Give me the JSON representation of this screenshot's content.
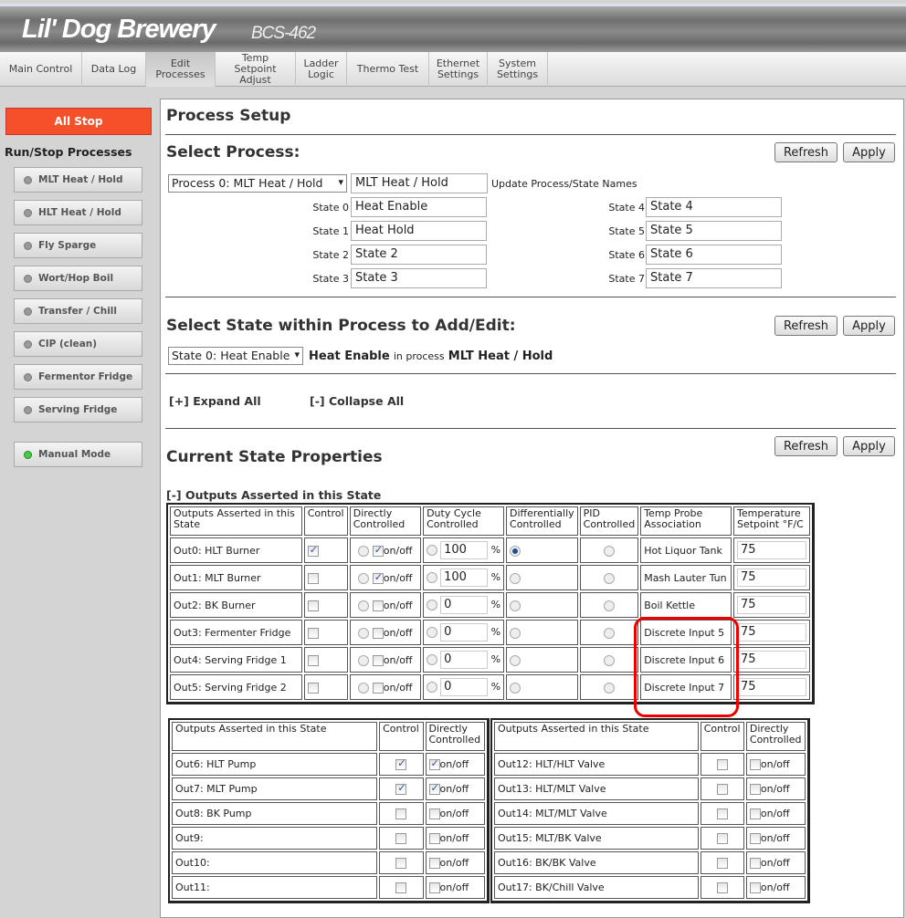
{
  "header": {
    "title": "Lil' Dog Brewery",
    "subtitle": "BCS-462"
  },
  "nav": [
    "Main Control",
    "Data Log",
    "Edit Processes",
    "Temp Setpoint Adjust",
    "Ladder Logic",
    "Thermo Test",
    "Ethernet Settings",
    "System Settings"
  ],
  "nav_active": 2,
  "sidebar": {
    "all_stop": "All Stop",
    "heading": "Run/Stop Processes",
    "processes": [
      "MLT Heat / Hold",
      "HLT Heat / Hold",
      "Fly Sparge",
      "Wort/Hop Boil",
      "Transfer / Chill",
      "CIP (clean)",
      "Fermentor Fridge",
      "Serving Fridge"
    ],
    "manual_mode": "Manual Mode"
  },
  "main": {
    "title": "Process Setup",
    "select_process": {
      "heading": "Select Process:",
      "refresh": "Refresh",
      "apply": "Apply",
      "selected": "Process 0: MLT Heat / Hold",
      "name": "MLT Heat / Hold",
      "update_label": "Update Process/State Names",
      "states": [
        {
          "label": "State 0",
          "value": "Heat Enable"
        },
        {
          "label": "State 1",
          "value": "Heat Hold"
        },
        {
          "label": "State 2",
          "value": "State 2"
        },
        {
          "label": "State 3",
          "value": "State 3"
        },
        {
          "label": "State 4",
          "value": "State 4"
        },
        {
          "label": "State 5",
          "value": "State 5"
        },
        {
          "label": "State 6",
          "value": "State 6"
        },
        {
          "label": "State 7",
          "value": "State 7"
        }
      ]
    },
    "select_state": {
      "heading": "Select State within Process to Add/Edit:",
      "refresh": "Refresh",
      "apply": "Apply",
      "selected": "State 0: Heat Enable",
      "state_name": "Heat Enable",
      "in_process": "in process",
      "process_name": "MLT Heat / Hold"
    },
    "expand": "[+] Expand All",
    "collapse": "[-] Collapse All",
    "current": {
      "heading": "Current State Properties",
      "refresh": "Refresh",
      "apply": "Apply",
      "outputs_heading": "[-] Outputs Asserted in this State"
    },
    "table1": {
      "headers": [
        "Outputs Asserted in this State",
        "Control",
        "Directly Controlled",
        "Duty Cycle Controlled",
        "Differentially Controlled",
        "PID Controlled",
        "Temp Probe Association",
        "Temperature Setpoint °F/C"
      ],
      "onoff": "on/off",
      "pct": "%",
      "rows": [
        {
          "name": "Out0: HLT Burner",
          "control": true,
          "direct": true,
          "duty": "100",
          "diff": true,
          "probe": "Hot Liquor Tank",
          "temp": "75"
        },
        {
          "name": "Out1: MLT Burner",
          "control": false,
          "direct": true,
          "duty": "100",
          "diff": false,
          "probe": "Mash Lauter Tun",
          "temp": "75"
        },
        {
          "name": "Out2: BK Burner",
          "control": false,
          "direct": false,
          "duty": "0",
          "diff": false,
          "probe": "Boil Kettle",
          "temp": "75"
        },
        {
          "name": "Out3: Fermenter Fridge",
          "control": false,
          "direct": false,
          "duty": "0",
          "diff": false,
          "probe": "Discrete Input 5",
          "temp": "75"
        },
        {
          "name": "Out4: Serving Fridge 1",
          "control": false,
          "direct": false,
          "duty": "0",
          "diff": false,
          "probe": "Discrete Input 6",
          "temp": "75"
        },
        {
          "name": "Out5: Serving Fridge 2",
          "control": false,
          "direct": false,
          "duty": "0",
          "diff": false,
          "probe": "Discrete Input 7",
          "temp": "75"
        }
      ]
    },
    "table2": {
      "headers": [
        "Outputs Asserted in this State",
        "Control",
        "Directly Controlled"
      ],
      "rows": [
        {
          "name": "Out6: HLT Pump",
          "control": true,
          "direct": true
        },
        {
          "name": "Out7: MLT Pump",
          "control": true,
          "direct": true
        },
        {
          "name": "Out8: BK Pump",
          "control": false,
          "direct": false
        },
        {
          "name": "Out9:",
          "control": false,
          "direct": false
        },
        {
          "name": "Out10:",
          "control": false,
          "direct": false
        },
        {
          "name": "Out11:",
          "control": false,
          "direct": false
        }
      ]
    },
    "table3": {
      "headers": [
        "Outputs Asserted in this State",
        "Control",
        "Directly Controlled"
      ],
      "rows": [
        {
          "name": "Out12: HLT/HLT Valve",
          "control": false,
          "direct": false
        },
        {
          "name": "Out13: HLT/MLT Valve",
          "control": false,
          "direct": false
        },
        {
          "name": "Out14: MLT/MLT Valve",
          "control": false,
          "direct": false
        },
        {
          "name": "Out15: MLT/BK Valve",
          "control": false,
          "direct": false
        },
        {
          "name": "Out16: BK/BK Valve",
          "control": false,
          "direct": false
        },
        {
          "name": "Out17: BK/Chill Valve",
          "control": false,
          "direct": false
        }
      ]
    }
  },
  "colors": {
    "all_stop": "#f4502a",
    "highlight": "#ee0000"
  }
}
